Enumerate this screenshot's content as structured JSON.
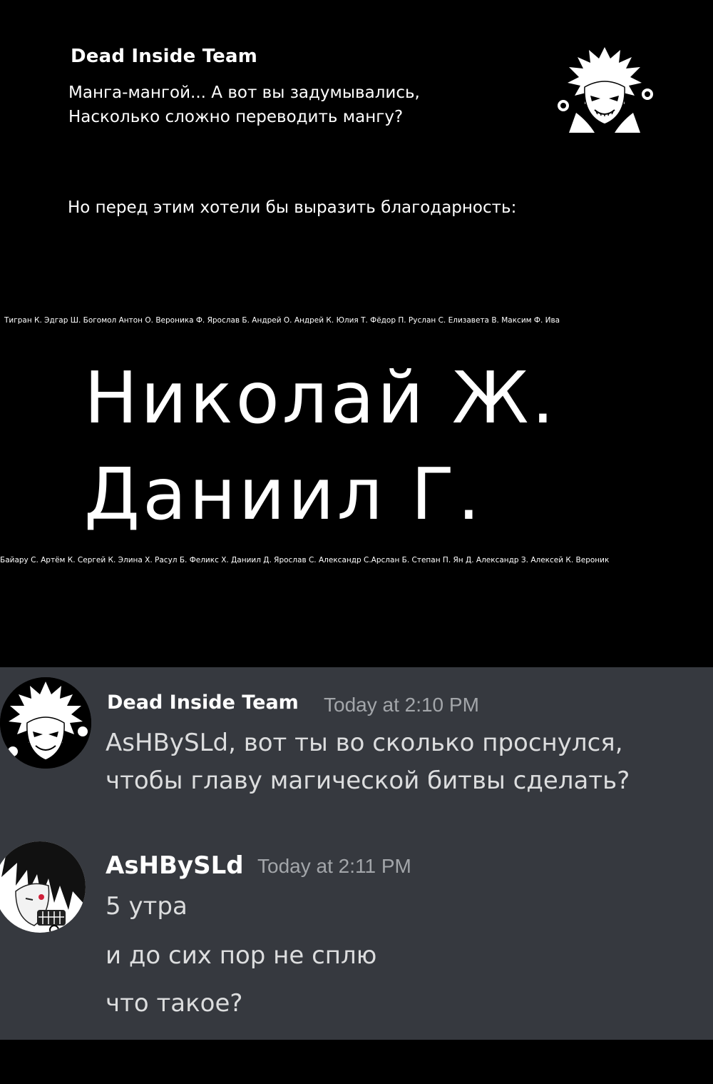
{
  "header": {
    "team_title": "Dead Inside Team",
    "intro": "Манга-мангой... А вот вы задумывались,\nНасколько сложно переводить мангу?",
    "thanks": "Но перед этим хотели бы выразить благодарность:",
    "logo_icon": "anime-character-logo-icon"
  },
  "credits": {
    "strip_top": "Тигран К.  Эдгар Ш.  Богомол  Антон О.  Вероника Ф.  Ярослав Б.  Андрей О.  Андрей К.  Юлия Т.  Фёдор П.  Руслан С.  Елизавета В.  Максим Ф.  Ива",
    "big_name_1": "Николай Ж.",
    "big_name_2": "Даниил Г.",
    "strip_bottom": "Байару С.  Артём К.  Сергей К.  Элина Х.  Расул Б.  Феликс Х.  Даниил Д.  Ярослав С.  Александр С.Арслан Б.  Степан П.  Ян Д.  Александр З.  Алексей К.  Вероник"
  },
  "chat": {
    "background": "#36393f",
    "messages": [
      {
        "author": "Dead Inside Team",
        "time": "Today at 2:10 PM",
        "avatar_icon": "dead-inside-avatar-icon",
        "lines": [
          "AsHBySLd, вот ты во сколько проснулся,",
          "чтобы главу магической битвы сделать?"
        ]
      },
      {
        "author": "AsHBySLd",
        "time": "Today at 2:11 PM",
        "avatar_icon": "ashbysld-avatar-icon",
        "lines": [
          "5 утра",
          "и до сих пор не сплю",
          "что такое?"
        ]
      }
    ]
  }
}
